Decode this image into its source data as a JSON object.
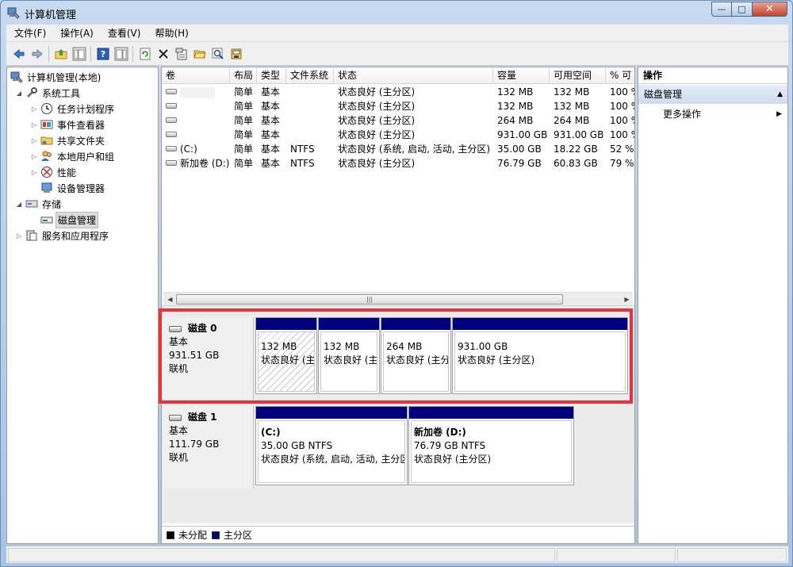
{
  "window": {
    "title": "计算机管理",
    "min_glyph": "—",
    "max_glyph": "□",
    "close_glyph": "✕"
  },
  "menu": [
    "文件(F)",
    "操作(A)",
    "查看(V)",
    "帮助(H)"
  ],
  "toolbar_icons": [
    "back-arrow-icon",
    "forward-arrow-icon",
    "up-folder-icon",
    "show-hide-tree-icon",
    "help-icon",
    "action-pane-icon",
    "refresh-icon",
    "delete-icon",
    "properties-icon",
    "open-folder-icon",
    "search-icon",
    "disk-settings-icon"
  ],
  "tree": {
    "root": "计算机管理(本地)",
    "system_tools": "系统工具",
    "task_scheduler": "任务计划程序",
    "event_viewer": "事件查看器",
    "shared_folders": "共享文件夹",
    "local_users": "本地用户和组",
    "performance": "性能",
    "device_manager": "设备管理器",
    "storage": "存储",
    "disk_management": "磁盘管理",
    "services_apps": "服务和应用程序"
  },
  "volume_table": {
    "headers": [
      "卷",
      "布局",
      "类型",
      "文件系统",
      "状态",
      "容量",
      "可用空间",
      "% 可"
    ],
    "rows": [
      {
        "volume": "",
        "layout": "简单",
        "type": "基本",
        "fs": "",
        "status": "状态良好 (主分区)",
        "capacity": "132 MB",
        "free": "132 MB",
        "pct": "100 %"
      },
      {
        "volume": "",
        "layout": "简单",
        "type": "基本",
        "fs": "",
        "status": "状态良好 (主分区)",
        "capacity": "132 MB",
        "free": "132 MB",
        "pct": "100 %"
      },
      {
        "volume": "",
        "layout": "简单",
        "type": "基本",
        "fs": "",
        "status": "状态良好 (主分区)",
        "capacity": "264 MB",
        "free": "264 MB",
        "pct": "100 %"
      },
      {
        "volume": "",
        "layout": "简单",
        "type": "基本",
        "fs": "",
        "status": "状态良好 (主分区)",
        "capacity": "931.00 GB",
        "free": "931.00 GB",
        "pct": "100 %"
      },
      {
        "volume": "(C:)",
        "layout": "简单",
        "type": "基本",
        "fs": "NTFS",
        "status": "状态良好 (系统, 启动, 活动, 主分区)",
        "capacity": "35.00 GB",
        "free": "18.22 GB",
        "pct": "52 %"
      },
      {
        "volume": "新加卷 (D:)",
        "layout": "简单",
        "type": "基本",
        "fs": "NTFS",
        "status": "状态良好 (主分区)",
        "capacity": "76.79 GB",
        "free": "60.83 GB",
        "pct": "79 %"
      }
    ],
    "scroll_grip": "|||"
  },
  "disks": [
    {
      "name": "磁盘 0",
      "type": "基本",
      "size": "931.51 GB",
      "state": "联机",
      "partitions": [
        {
          "label": "",
          "size": "132 MB",
          "status": "状态良好 (主"
        },
        {
          "label": "",
          "size": "132 MB",
          "status": "状态良好 (主"
        },
        {
          "label": "",
          "size": "264 MB",
          "status": "状态良好 (主分"
        },
        {
          "label": "",
          "size": "931.00 GB",
          "status": "状态良好 (主分区)"
        }
      ]
    },
    {
      "name": "磁盘 1",
      "type": "基本",
      "size": "111.79 GB",
      "state": "联机",
      "partitions": [
        {
          "label": "(C:)",
          "size": "35.00 GB NTFS",
          "status": "状态良好 (系统, 启动, 活动, 主分区"
        },
        {
          "label": "新加卷 (D:)",
          "size": "76.79 GB NTFS",
          "status": "状态良好 (主分区)"
        }
      ]
    }
  ],
  "legend": [
    {
      "label": "未分配",
      "color": "#000000"
    },
    {
      "label": "主分区",
      "color": "#00007f"
    }
  ],
  "actions": {
    "header": "操作",
    "section": "磁盘管理",
    "item": "更多操作"
  },
  "colors": {
    "partition_bar": "#00007f",
    "highlight": "#e8323c"
  }
}
